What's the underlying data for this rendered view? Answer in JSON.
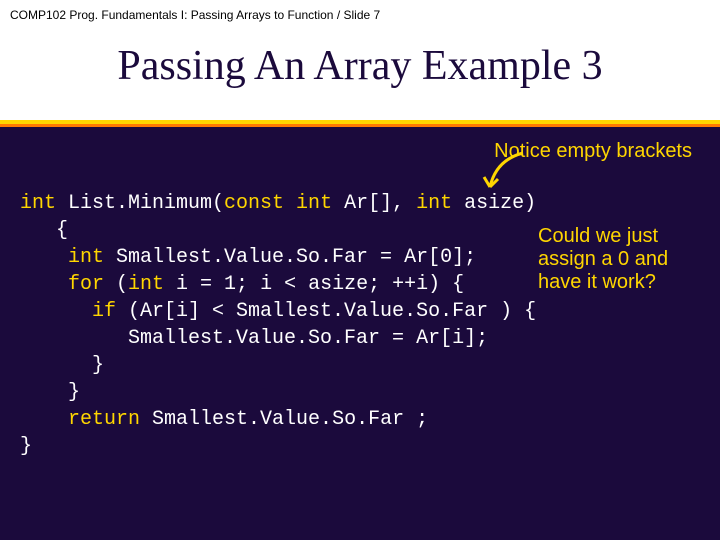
{
  "header": {
    "course_line": "COMP102  Prog. Fundamentals I: Passing Arrays to Function / Slide 7",
    "title": "Passing An Array Example 3"
  },
  "annotations": {
    "top": "Notice empty brackets",
    "side": "Could we just assign  a 0 and have it work?"
  },
  "code": {
    "l1a": "int",
    "l1b": " List.Minimum(",
    "l1c": "const int",
    "l1d": " Ar[], ",
    "l1e": "int",
    "l1f": " asize)",
    "l2": "   {",
    "l3a": "    int",
    "l3b": " Smallest.Value.So.Far = Ar[0];",
    "l4a": "    for",
    "l4b": " (",
    "l4c": "int",
    "l4d": " i = 1; i < asize; ++i) {",
    "l5a": "      if",
    "l5b": " (Ar[i] < Smallest.Value.So.Far ) {",
    "l6": "         Smallest.Value.So.Far = Ar[i];",
    "l7": "      }",
    "l8": "    }",
    "l9a": "    return",
    "l9b": " Smallest.Value.So.Far ;",
    "l10": "}"
  }
}
